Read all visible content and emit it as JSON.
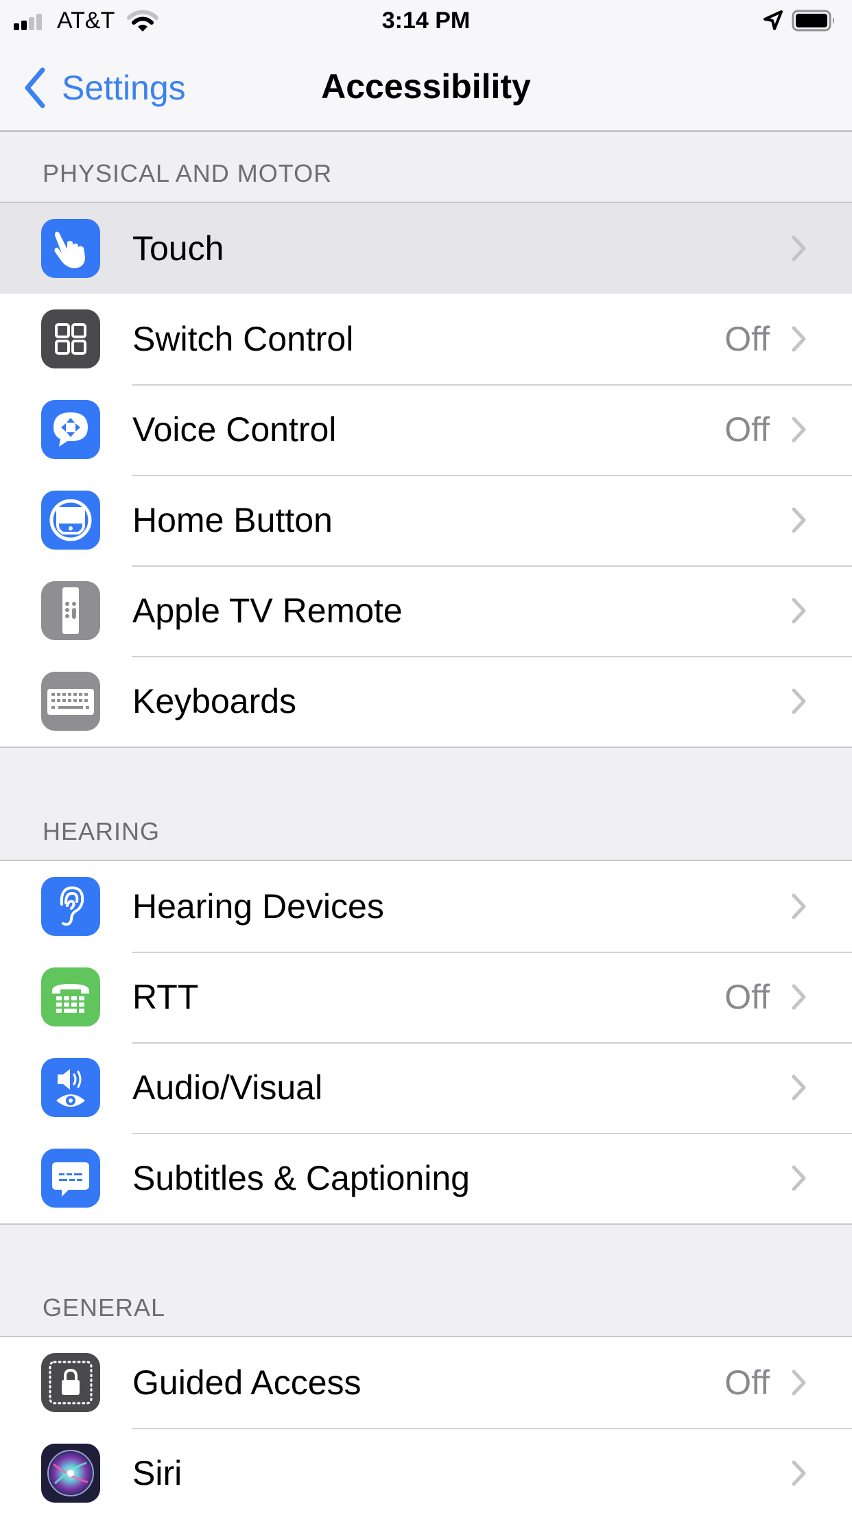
{
  "status_bar": {
    "carrier": "AT&T",
    "time": "3:14 PM",
    "signal_bars_filled": 2,
    "signal_bars_total": 4,
    "icons": [
      "signal-icon",
      "wifi-icon",
      "location-arrow-icon",
      "battery-icon"
    ]
  },
  "nav": {
    "back_label": "Settings",
    "title": "Accessibility"
  },
  "colors": {
    "accent": "#3b82f0",
    "blue_icon": "#3478f6",
    "dark_icon": "#4a4a4c",
    "gray_icon": "#8e8e93",
    "green_icon": "#5fc55c",
    "row_highlight": "#e5e5ea",
    "background": "#efeff4"
  },
  "sections": [
    {
      "header": "PHYSICAL AND MOTOR",
      "items": [
        {
          "label": "Touch",
          "value": "",
          "icon": "touch-hand-icon",
          "highlighted": true
        },
        {
          "label": "Switch Control",
          "value": "Off",
          "icon": "switch-control-grid-icon"
        },
        {
          "label": "Voice Control",
          "value": "Off",
          "icon": "voice-control-bubble-icon"
        },
        {
          "label": "Home Button",
          "value": "",
          "icon": "home-button-icon"
        },
        {
          "label": "Apple TV Remote",
          "value": "",
          "icon": "apple-tv-remote-icon"
        },
        {
          "label": "Keyboards",
          "value": "",
          "icon": "keyboard-icon"
        }
      ]
    },
    {
      "header": "HEARING",
      "items": [
        {
          "label": "Hearing Devices",
          "value": "",
          "icon": "ear-icon"
        },
        {
          "label": "RTT",
          "value": "Off",
          "icon": "rtt-telephone-icon"
        },
        {
          "label": "Audio/Visual",
          "value": "",
          "icon": "speaker-eye-icon"
        },
        {
          "label": "Subtitles & Captioning",
          "value": "",
          "icon": "subtitles-bubble-icon"
        }
      ]
    },
    {
      "header": "GENERAL",
      "items": [
        {
          "label": "Guided Access",
          "value": "Off",
          "icon": "guided-access-lock-icon"
        },
        {
          "label": "Siri",
          "value": "",
          "icon": "siri-icon"
        }
      ]
    }
  ]
}
